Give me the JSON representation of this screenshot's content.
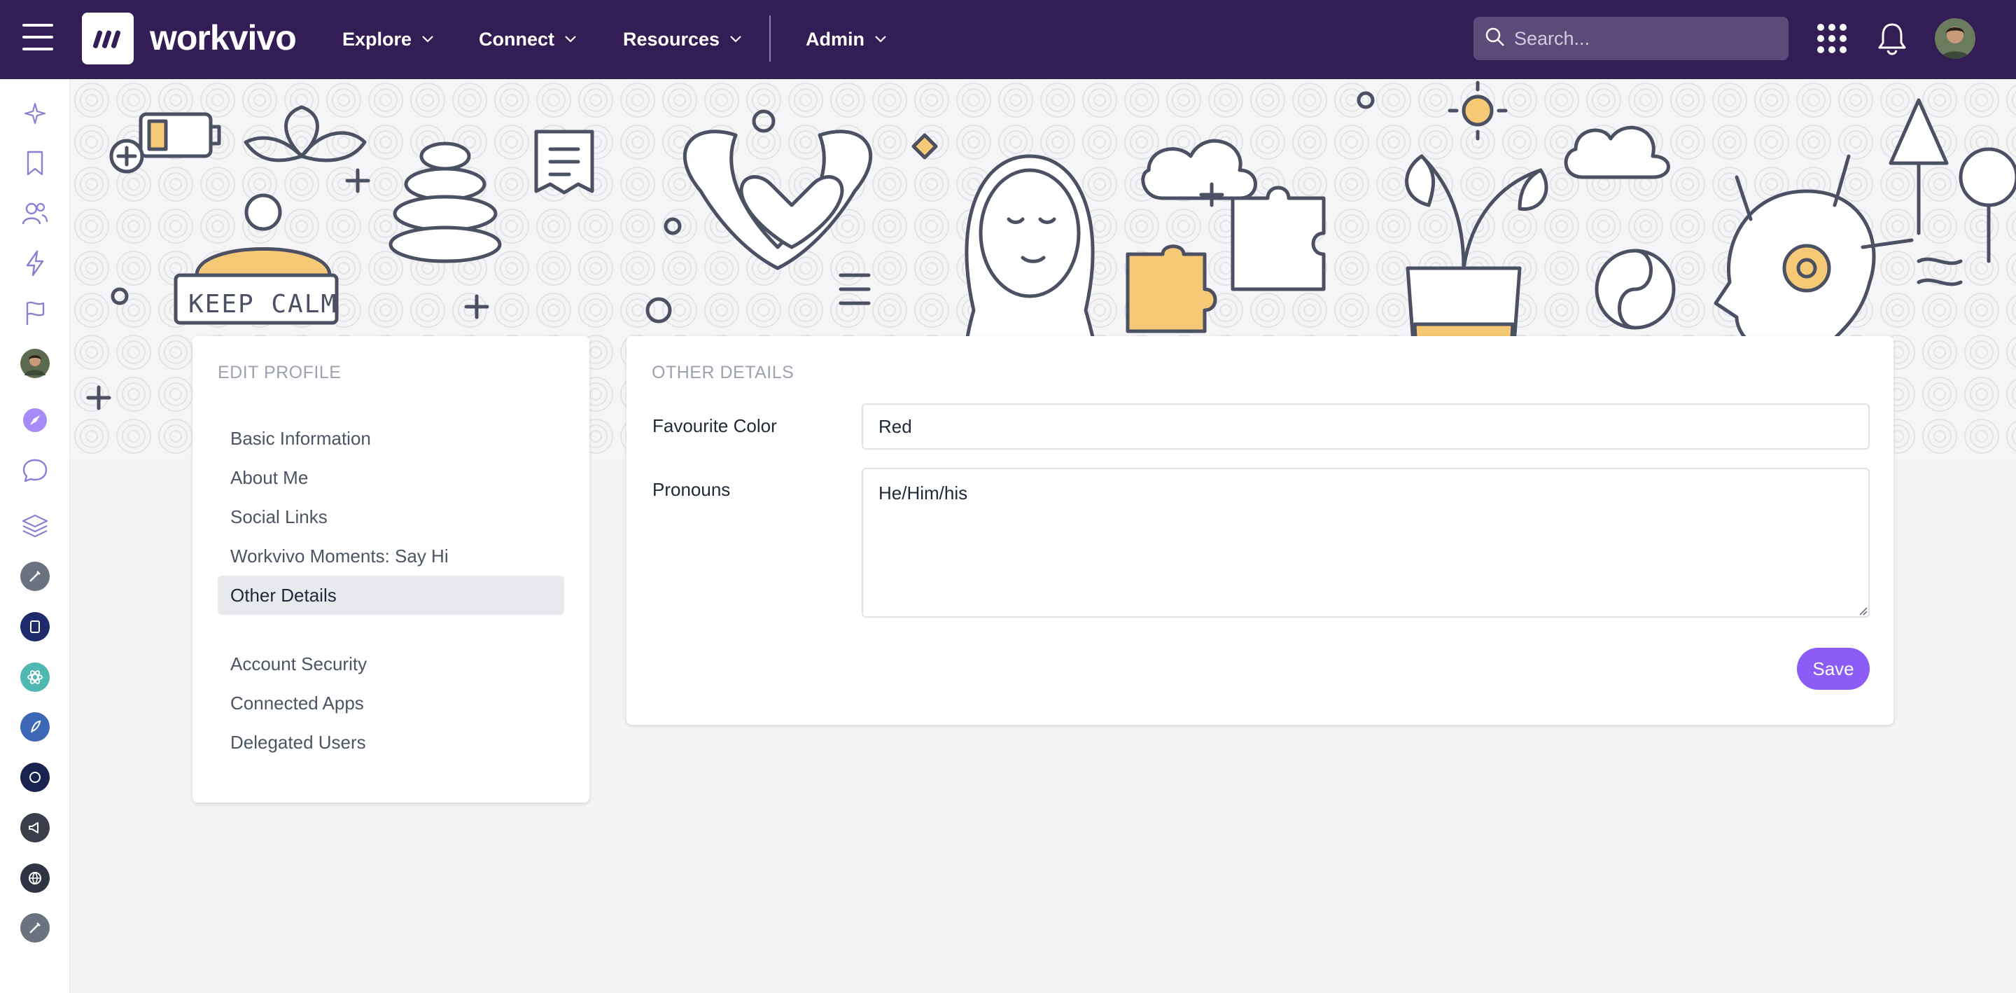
{
  "app": {
    "brand": "workvivo"
  },
  "nav": {
    "items": [
      {
        "label": "Explore"
      },
      {
        "label": "Connect"
      },
      {
        "label": "Resources"
      },
      {
        "label": "Admin"
      }
    ]
  },
  "search": {
    "placeholder": "Search..."
  },
  "banner": {
    "sign_text": "KEEP CALM"
  },
  "edit_profile": {
    "heading": "EDIT PROFILE",
    "items": [
      {
        "label": "Basic Information"
      },
      {
        "label": "About Me"
      },
      {
        "label": "Social Links"
      },
      {
        "label": "Workvivo Moments: Say Hi"
      },
      {
        "label": "Other Details",
        "active": true
      },
      {
        "label": "Account Security"
      },
      {
        "label": "Connected Apps"
      },
      {
        "label": "Delegated Users"
      }
    ]
  },
  "other_details": {
    "heading": "OTHER DETAILS",
    "favourite_color": {
      "label": "Favourite Color",
      "value": "Red"
    },
    "pronouns": {
      "label": "Pronouns",
      "value": "He/Him/his"
    },
    "save_label": "Save"
  },
  "colors": {
    "topbar": "#321d55",
    "accent": "#8b5cf6",
    "banner_yellow": "#f6c976"
  }
}
